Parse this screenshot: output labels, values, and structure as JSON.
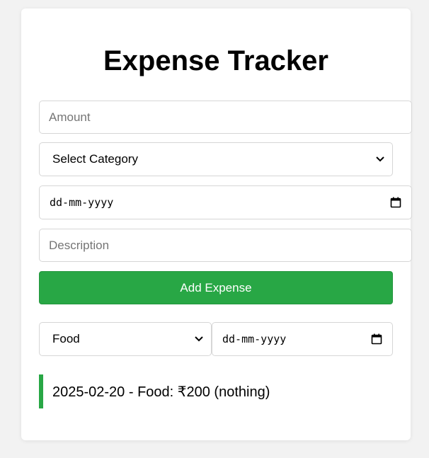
{
  "app": {
    "title": "Expense Tracker"
  },
  "form": {
    "amount_placeholder": "Amount",
    "category_selected": "Select Category",
    "date_placeholder": "dd-mm-yyyy",
    "description_placeholder": "Description",
    "add_button_label": "Add Expense"
  },
  "filters": {
    "category_selected": "Food",
    "date_placeholder": "dd-mm-yyyy"
  },
  "expenses": [
    {
      "text": "2025-02-20 - Food: ₹200 (nothing)"
    }
  ],
  "colors": {
    "accent": "#28a745",
    "background": "#f2f2f2",
    "card": "#ffffff",
    "border": "#d6d6d6"
  },
  "icons": {
    "dropdown": "chevron-down-icon",
    "date": "calendar-icon"
  }
}
